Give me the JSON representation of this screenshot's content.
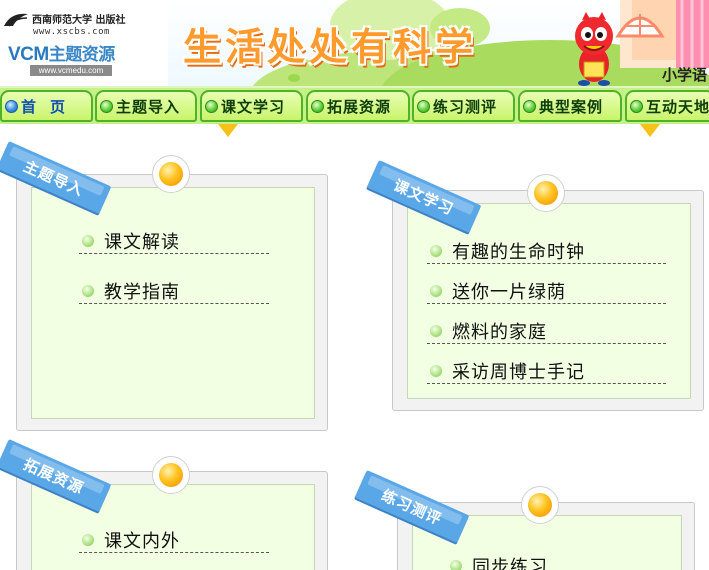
{
  "header": {
    "publisher": "西南师范大学 出版社",
    "publisher_url": "www.xscbs.com",
    "vcm_logo": "VCM",
    "vcm_logo_cn": "主题资源",
    "vcm_url": "www.vcmedu.com",
    "title": "生活处处有科学",
    "grade_label": "小学语"
  },
  "nav": {
    "items": [
      {
        "label": "首页"
      },
      {
        "label": "主题导入"
      },
      {
        "label": "课文学习"
      },
      {
        "label": "拓展资源"
      },
      {
        "label": "练习测评"
      },
      {
        "label": "典型案例"
      },
      {
        "label": "互动天地"
      }
    ]
  },
  "sections": [
    {
      "title": "主题导入",
      "links": [
        "课文解读",
        "教学指南"
      ]
    },
    {
      "title": "课文学习",
      "links": [
        "有趣的生命时钟",
        "送你一片绿荫",
        "燃料的家庭",
        "采访周博士手记"
      ]
    },
    {
      "title": "拓展资源",
      "links": [
        "课文内外"
      ]
    },
    {
      "title": "练习测评",
      "links": [
        "同步练习"
      ]
    }
  ],
  "colors": {
    "title_orange": "#ff9a2c",
    "nav_green": "#c5f08a",
    "nav_border": "#4fb325",
    "ribbon_blue": "#5aa7e8",
    "card_inner": "#f2ffe2"
  }
}
